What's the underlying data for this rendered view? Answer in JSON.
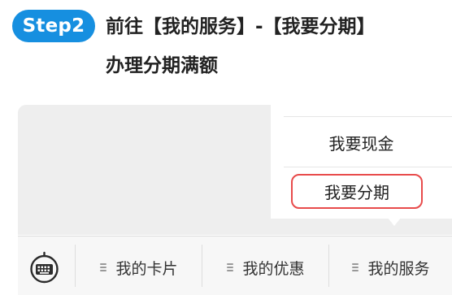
{
  "header": {
    "step_badge": "Step2",
    "title_line1": "前往【我的服务】-【我要分期】",
    "title_line2": "办理分期满额"
  },
  "popup_menu": {
    "items": [
      {
        "label": "我要现金"
      },
      {
        "label": "我要分期",
        "highlighted": true
      }
    ]
  },
  "bottom_bar": {
    "keyboard_icon": "keyboard-icon",
    "tabs": [
      {
        "label": "我的卡片",
        "icon": "menu-lines-icon"
      },
      {
        "label": "我的优惠",
        "icon": "menu-lines-icon"
      },
      {
        "label": "我的服务",
        "icon": "menu-lines-icon"
      }
    ]
  },
  "colors": {
    "accent": "#168fe0",
    "highlight_border": "#e84b4b",
    "panel_bg": "#eeeeee"
  }
}
